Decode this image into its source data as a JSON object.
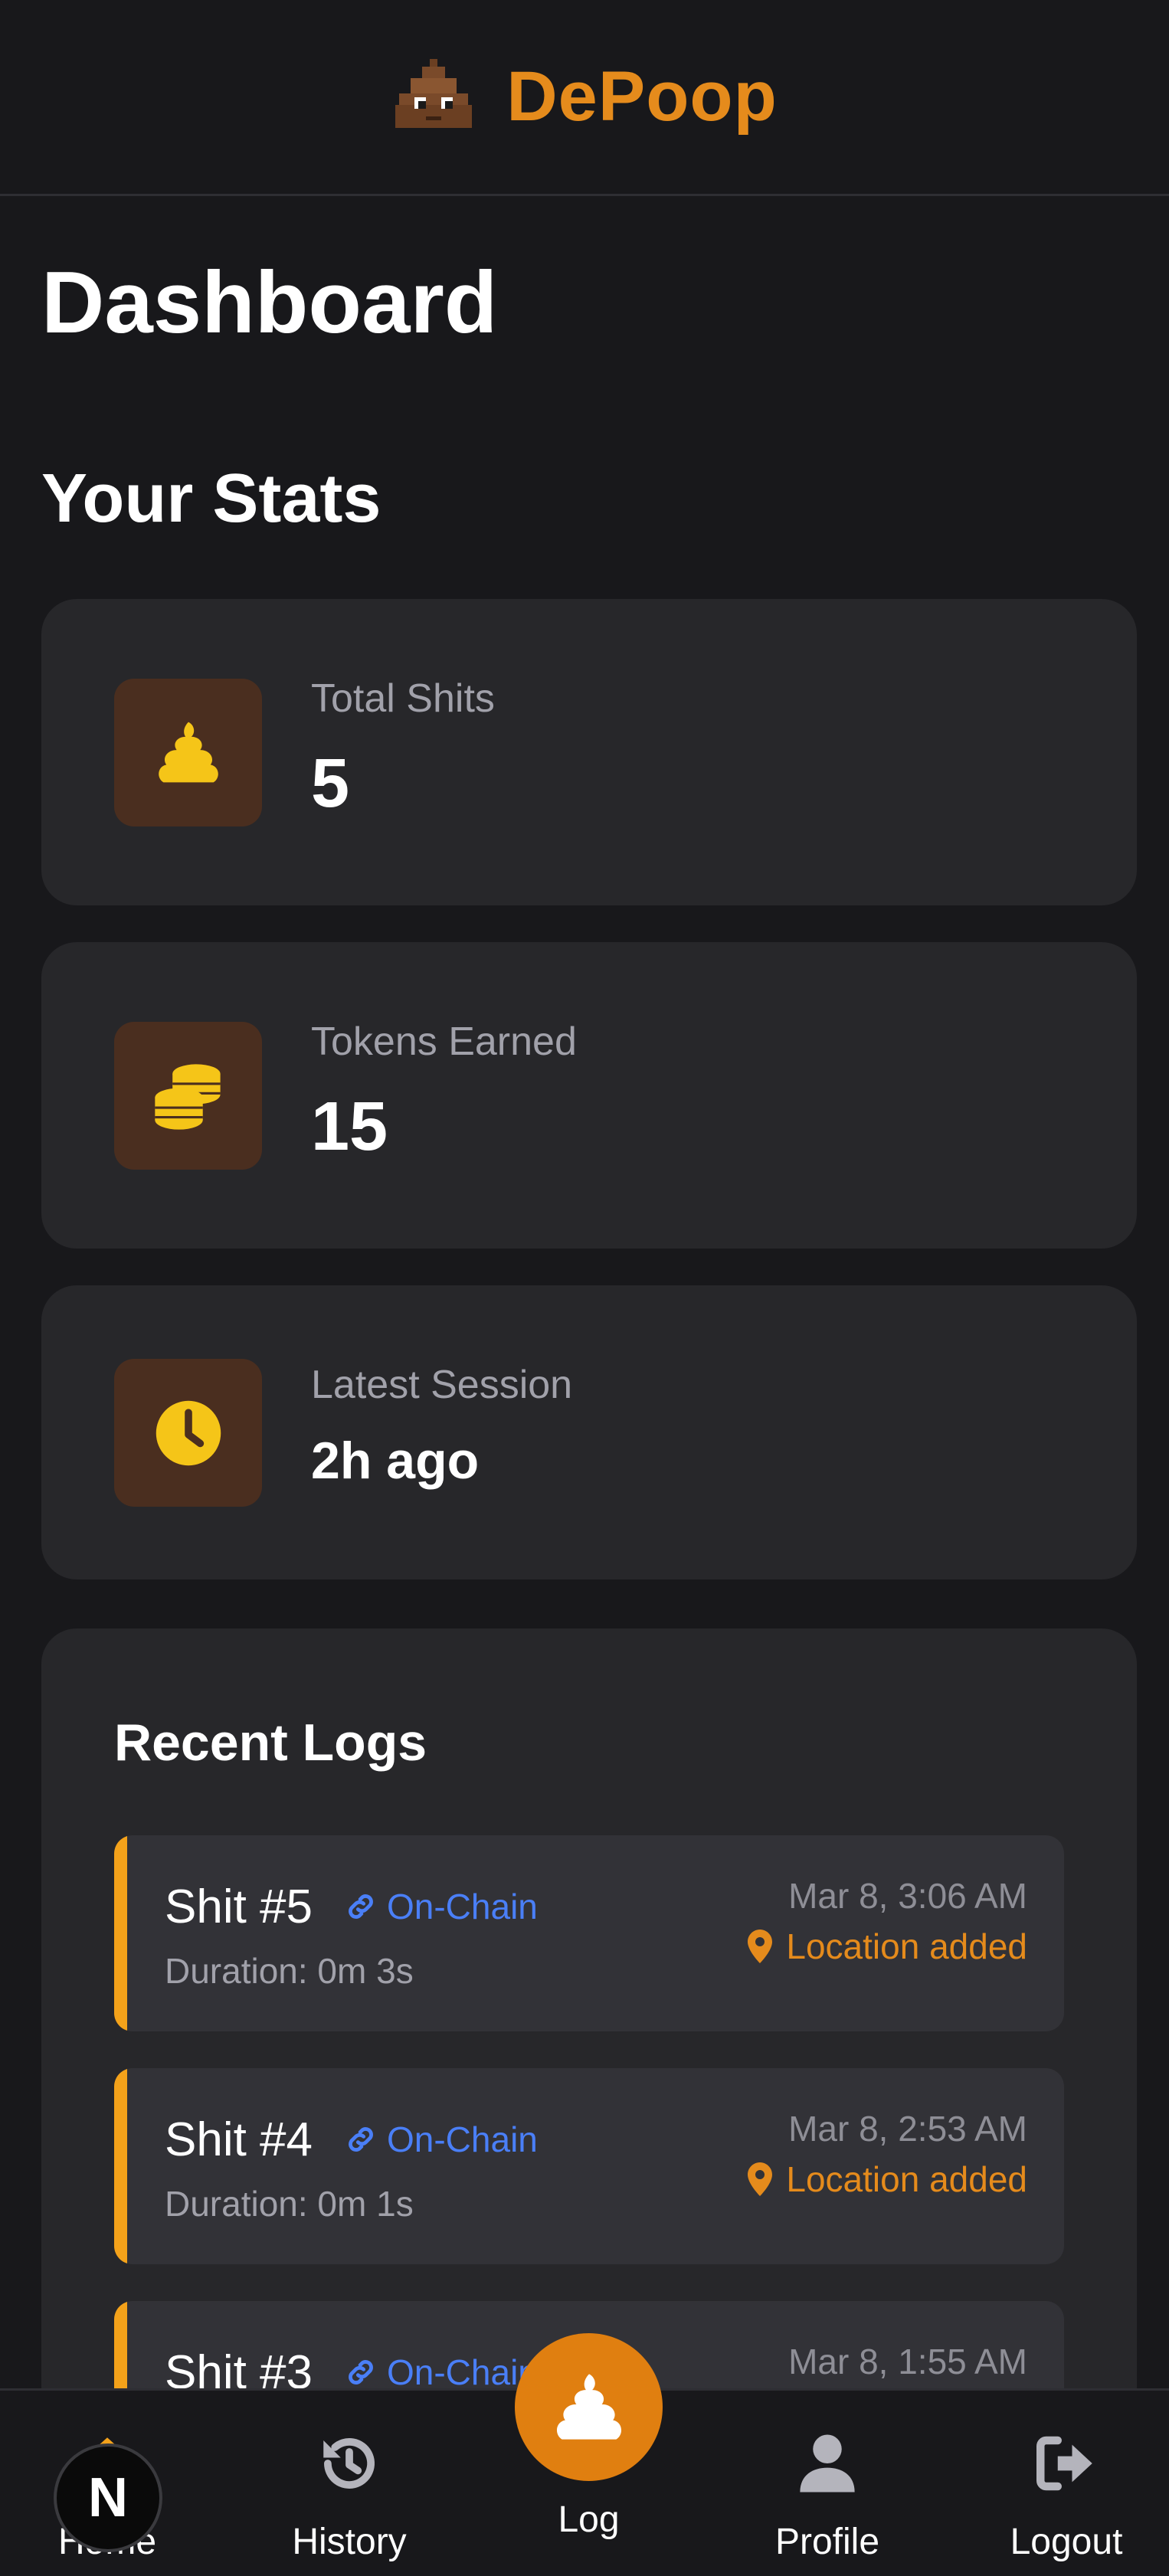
{
  "header": {
    "brand": "DePoop",
    "logo_icon": "poop-emoji-icon"
  },
  "page_title": "Dashboard",
  "stats_section": {
    "title": "Your Stats",
    "cards": [
      {
        "icon": "poop-icon",
        "label": "Total Shits",
        "value": "5"
      },
      {
        "icon": "coins-icon",
        "label": "Tokens Earned",
        "value": "15"
      },
      {
        "icon": "clock-icon",
        "label": "Latest Session",
        "value": "2h ago"
      }
    ]
  },
  "recent_logs": {
    "title": "Recent Logs",
    "items": [
      {
        "name": "Shit #5",
        "badge": "On-Chain",
        "duration": "Duration: 0m 3s",
        "time": "Mar 8, 3:06 AM",
        "location": "Location added"
      },
      {
        "name": "Shit #4",
        "badge": "On-Chain",
        "duration": "Duration: 0m 1s",
        "time": "Mar 8, 2:53 AM",
        "location": "Location added"
      },
      {
        "name": "Shit #3",
        "badge": "On-Chain",
        "duration": "",
        "time": "Mar 8, 1:55 AM",
        "location": ""
      }
    ]
  },
  "bottom_nav": {
    "home_label": "Home",
    "history_label": "History",
    "log_label": "Log",
    "profile_label": "Profile",
    "logout_label": "Logout"
  },
  "dev_badge": {
    "letter": "N"
  },
  "colors": {
    "background": "#18181b",
    "card": "#27272a",
    "accent_orange": "#e58b1c",
    "icon_bg": "#4a2e1f",
    "icon_yellow": "#f5c518",
    "chain_blue": "#4a7ff7",
    "log_bar": "#f4a21a"
  }
}
